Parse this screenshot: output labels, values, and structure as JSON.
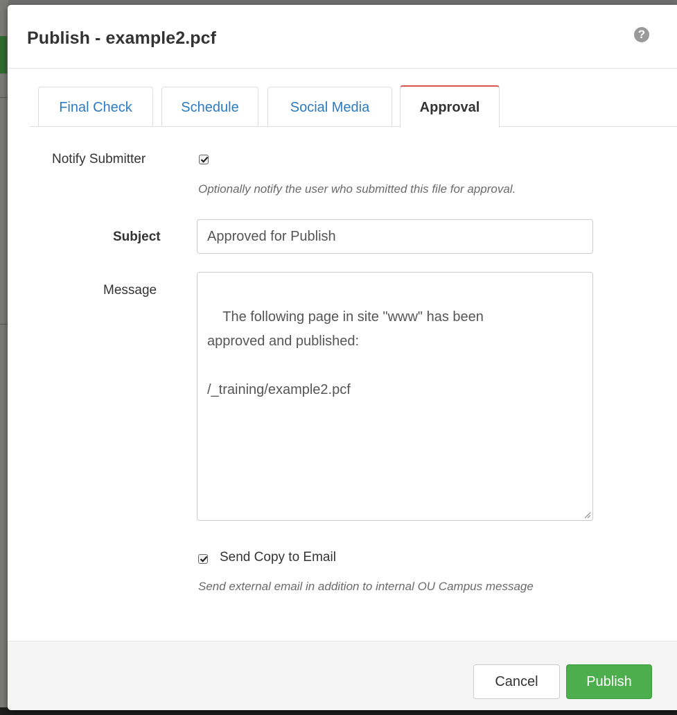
{
  "dialog": {
    "title": "Publish - example2.pcf",
    "help_icon": "question-circle-icon"
  },
  "tabs": [
    {
      "label": "Final Check",
      "active": false
    },
    {
      "label": "Schedule",
      "active": false
    },
    {
      "label": "Social Media",
      "active": false
    },
    {
      "label": "Approval",
      "active": true
    }
  ],
  "form": {
    "notify_submitter": {
      "label": "Notify Submitter",
      "checked": true,
      "help": "Optionally notify the user who submitted this file for approval."
    },
    "subject": {
      "label": "Subject",
      "value": "Approved for Publish"
    },
    "message": {
      "label": "Message",
      "value": "The following page in site \"www\" has been\napproved and published:\n\n/_training/example2.pcf"
    },
    "send_copy": {
      "label": "Send Copy to Email",
      "checked": true,
      "help": "Send external email in addition to internal OU Campus message"
    }
  },
  "footer": {
    "cancel_label": "Cancel",
    "publish_label": "Publish"
  },
  "colors": {
    "link": "#2a7bc2",
    "active_tab_accent": "#d9534f",
    "publish_button": "#4cae4c"
  }
}
